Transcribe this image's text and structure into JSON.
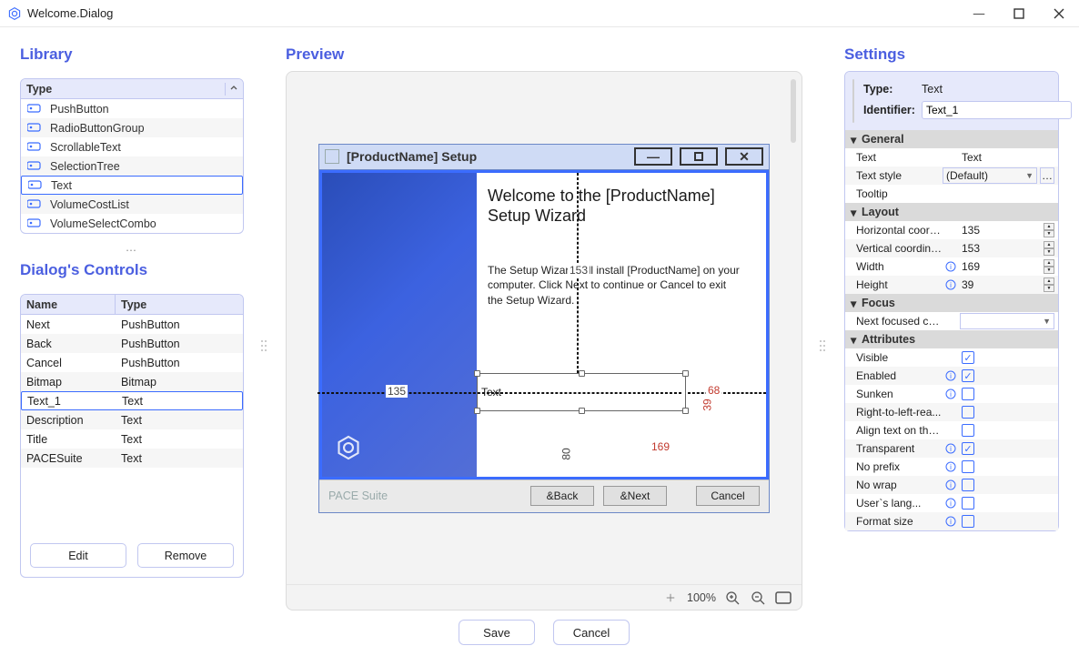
{
  "window": {
    "title": "Welcome.Dialog"
  },
  "sections": {
    "library": "Library",
    "preview": "Preview",
    "settings": "Settings",
    "dialog_controls": "Dialog's Controls"
  },
  "library": {
    "header": "Type",
    "items": [
      {
        "label": "PushButton"
      },
      {
        "label": "RadioButtonGroup"
      },
      {
        "label": "ScrollableText"
      },
      {
        "label": "SelectionTree"
      },
      {
        "label": "Text",
        "selected": true
      },
      {
        "label": "VolumeCostList"
      },
      {
        "label": "VolumeSelectCombo"
      }
    ]
  },
  "dialog_controls": {
    "cols": [
      "Name",
      "Type"
    ],
    "rows": [
      {
        "name": "Next",
        "type": "PushButton"
      },
      {
        "name": "Back",
        "type": "PushButton"
      },
      {
        "name": "Cancel",
        "type": "PushButton"
      },
      {
        "name": "Bitmap",
        "type": "Bitmap"
      },
      {
        "name": "Text_1",
        "type": "Text",
        "selected": true
      },
      {
        "name": "Description",
        "type": "Text"
      },
      {
        "name": "Title",
        "type": "Text"
      },
      {
        "name": "PACESuite",
        "type": "Text"
      }
    ],
    "buttons": {
      "edit": "Edit",
      "remove": "Remove"
    }
  },
  "preview": {
    "zoom": "100%",
    "dialog_title": "[ProductName] Setup",
    "headline": "Welcome to the [ProductName] Setup Wizard",
    "description": "The Setup Wizard will install [ProductName] on your computer. Click Next to continue or Cancel to exit the Setup Wizard.",
    "selected_text": "Text",
    "footer_brand": "PACE Suite",
    "buttons": {
      "back": "&Back",
      "next": "&Next",
      "cancel": "Cancel"
    },
    "dims": {
      "x": "135",
      "y": "153",
      "w": "169",
      "h": "39",
      "right_gap": "68",
      "bottom_gap": "80"
    }
  },
  "settings": {
    "top": {
      "type_label": "Type:",
      "type_value": "Text",
      "id_label": "Identifier:",
      "id_value": "Text_1"
    },
    "groups": {
      "general": {
        "title": "General",
        "props": [
          {
            "k": "Text",
            "v": "Text"
          },
          {
            "k": "Text style",
            "v": "(Default)",
            "dropdown": true,
            "ellipsis": true
          },
          {
            "k": "Tooltip",
            "v": ""
          }
        ]
      },
      "layout": {
        "title": "Layout",
        "props": [
          {
            "k": "Horizontal coordi...",
            "v": "135",
            "spinner": true
          },
          {
            "k": "Vertical coordina...",
            "v": "153",
            "spinner": true
          },
          {
            "k": "Width",
            "v": "169",
            "spinner": true,
            "info": true
          },
          {
            "k": "Height",
            "v": "39",
            "spinner": true,
            "info": true
          }
        ]
      },
      "focus": {
        "title": "Focus",
        "props": [
          {
            "k": "Next focused co...",
            "v": "",
            "dropdown": true
          }
        ]
      },
      "attributes": {
        "title": "Attributes",
        "props": [
          {
            "k": "Visible",
            "chk": true
          },
          {
            "k": "Enabled",
            "chk": true,
            "info": true
          },
          {
            "k": "Sunken",
            "chk": false,
            "info": true
          },
          {
            "k": "Right-to-left-rea...",
            "chk": false
          },
          {
            "k": "Align text on the...",
            "chk": false
          },
          {
            "k": "Transparent",
            "chk": true,
            "info": true
          },
          {
            "k": "No prefix",
            "chk": false,
            "info": true
          },
          {
            "k": "No wrap",
            "chk": false,
            "info": true
          },
          {
            "k": "User`s lang...",
            "chk": false,
            "info": true
          },
          {
            "k": "Format size",
            "chk": false,
            "info": true
          }
        ]
      }
    }
  },
  "footer": {
    "save": "Save",
    "cancel": "Cancel"
  }
}
